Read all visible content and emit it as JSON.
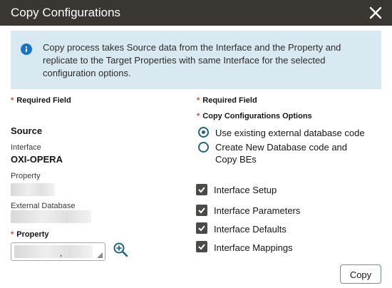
{
  "dialog": {
    "title": "Copy Configurations",
    "close_icon": "close-icon"
  },
  "banner": {
    "icon": "info-icon",
    "message": "Copy process takes Source data from the Interface and the Property and replicate to the Target Properties with same Interface for the selected configuration options."
  },
  "left": {
    "required_label": "Required Field",
    "source_heading": "Source",
    "interface_label": "Interface",
    "interface_value": "OXI-OPERA",
    "property_label": "Property",
    "external_db_label": "External Database",
    "property_field_label": "Property",
    "property_select_icon": "chevron-down-icon",
    "lookup_icon": "zoom-search-icon"
  },
  "right": {
    "required_label": "Required Field",
    "options_label": "Copy Configurations Options",
    "radio_options": [
      {
        "label": "Use existing external database code",
        "checked": true
      },
      {
        "label": "Create New Database code and Copy BEs",
        "checked": false
      }
    ],
    "checkboxes": [
      {
        "label": "Interface Setup",
        "checked": true
      },
      {
        "label": "Interface Parameters",
        "checked": true
      },
      {
        "label": "Interface Defaults",
        "checked": true
      },
      {
        "label": "Interface Mappings",
        "checked": true
      }
    ]
  },
  "footer": {
    "copy_label": "Copy"
  },
  "colors": {
    "titlebar": "#3a3632",
    "banner": "#d9e9f2",
    "required_star": "#c74634",
    "radio_accent": "#216583",
    "checkbox": "#4a4a48"
  }
}
